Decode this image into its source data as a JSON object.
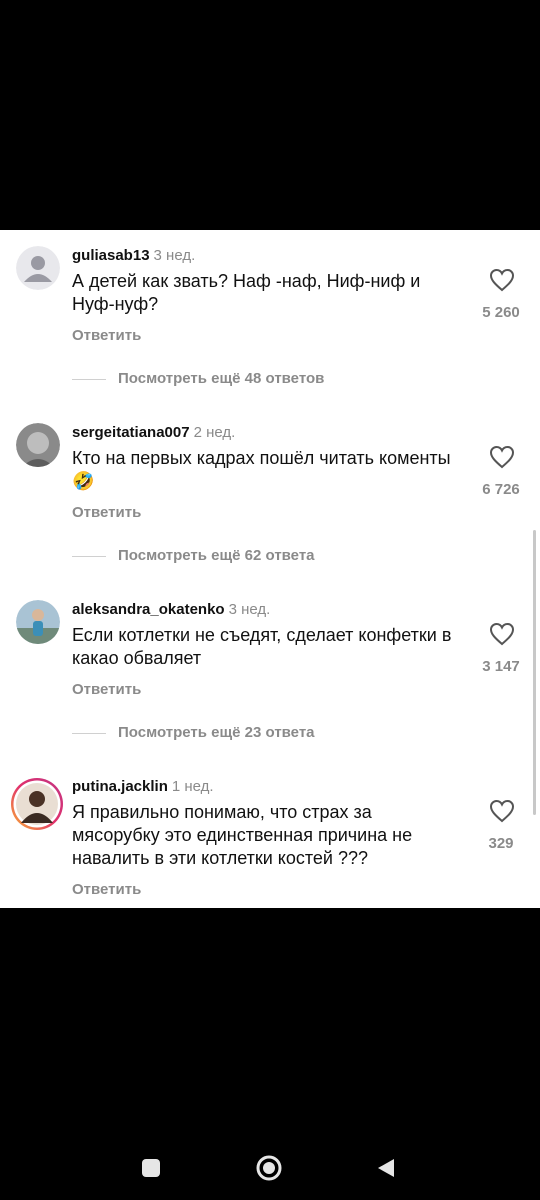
{
  "comments": [
    {
      "username": "guliasab13",
      "time": "3 нед.",
      "text": "А детей как звать? Наф -наф, Ниф-ниф и Нуф-нуф?",
      "reply_label": "Ответить",
      "likes": "5 260",
      "view_more": "Посмотреть ещё 48 ответов",
      "avatar": "default-avatar-icon"
    },
    {
      "username": "sergeitatiana007",
      "time": "2 нед.",
      "text": "Кто на первых кадрах пошёл читать коменты🤣",
      "reply_label": "Ответить",
      "likes": "6 726",
      "view_more": "Посмотреть ещё 62 ответа",
      "avatar": "photo-avatar"
    },
    {
      "username": "aleksandra_okatenko",
      "time": "3 нед.",
      "text": "Если котлетки не съедят, сделает конфетки в какао обваляет",
      "reply_label": "Ответить",
      "likes": "3 147",
      "view_more": "Посмотреть ещё 23 ответа",
      "avatar": "photo-avatar"
    },
    {
      "username": "putina.jacklin",
      "time": "1 нед.",
      "text": "Я правильно понимаю, что страх за мясорубку это единственная причина не навалить в эти котлетки костей ???",
      "reply_label": "Ответить",
      "likes": "329",
      "avatar": "story-ring-avatar"
    }
  ],
  "navbar": {
    "icons": [
      "recent-apps-icon",
      "home-icon",
      "back-icon"
    ]
  }
}
